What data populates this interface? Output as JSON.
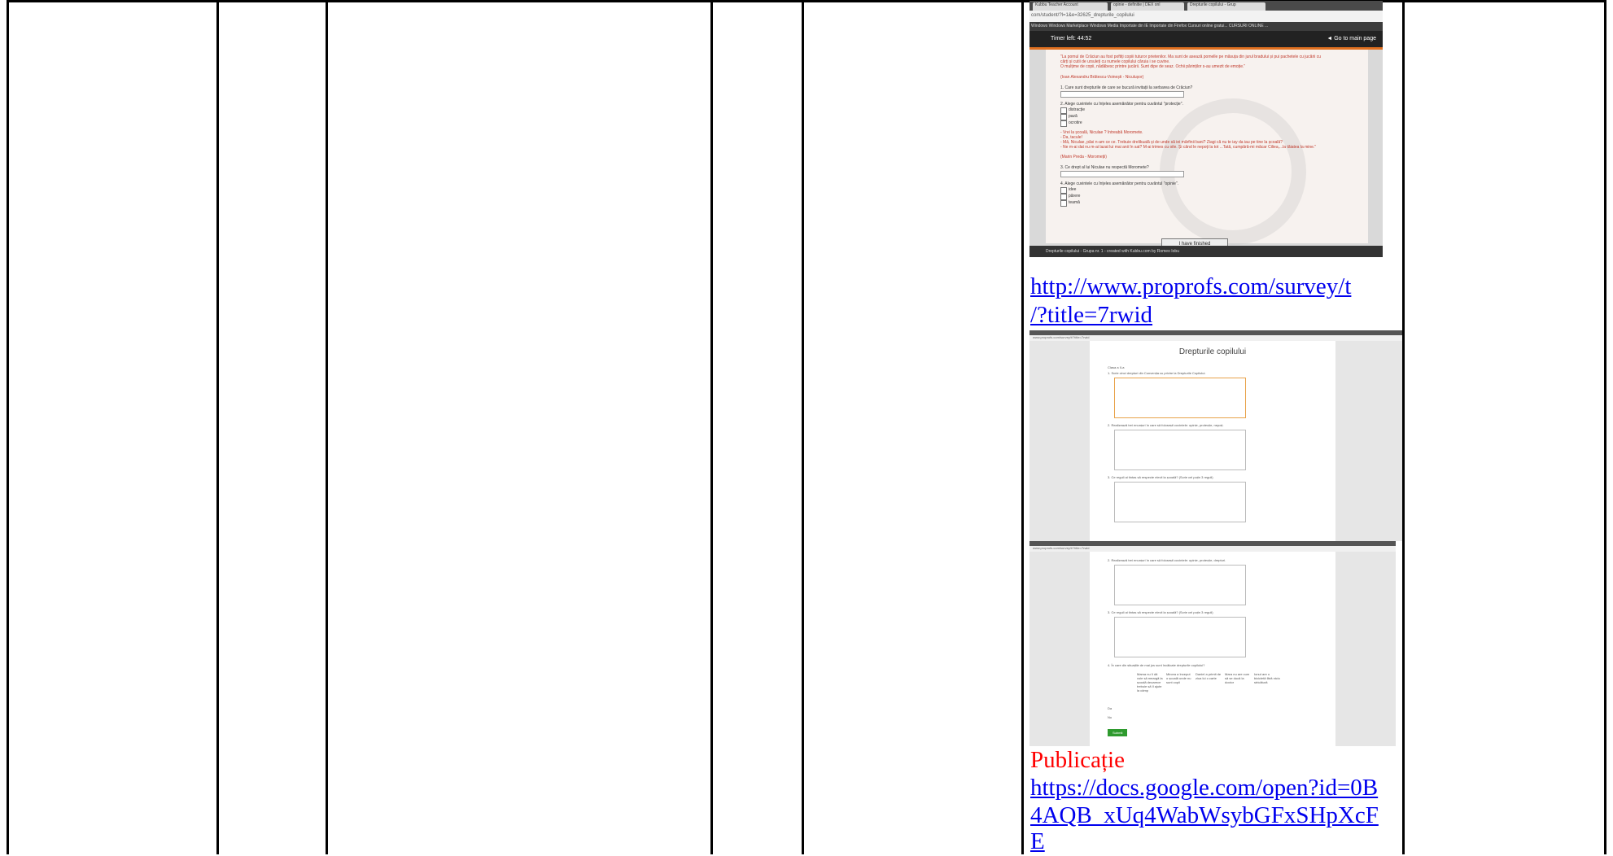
{
  "kubbu_screenshot": {
    "tabs": [
      "Kubbu Teacher Account",
      "opinie - definitie | DEX onl",
      "Drepturile copilului - Grup"
    ],
    "url": "com/student/?l=1&e=32625_drepturile_copilului",
    "bookmarks": "Windows  Windows Marketplace  Windows Media  Importate din IE  Importate din Firefox  Cursuri online gratui...  CURSURI ONLINE ...",
    "timer": "Timer left: 44:52",
    "back_label": "◄ Go to main page",
    "lines": [
      {
        "text": "\"La pomul de Crăciun au fost poftiți copiii tuturor prietenilor. Ma sunt de asează pomelle pe măsuța din jurul bradului și pui pachetele cu jucării cu",
        "red": true
      },
      {
        "text": "cărți și cutii de ursuleți cu numele copilului căruia i se cuvine.",
        "red": true
      },
      {
        "text": "O mulțime de copii, nădăbesc printre jucării. Sunt dipe de seaz. Ochii părinților s-au umezit de emoție.\"",
        "red": true
      },
      {
        "text": "(Ioan Alexandru Brătescu-Voinești - Niculușor)",
        "red": true
      },
      {
        "text": "1. Care sunt drepturile de care se bucură invitații la serbarea de Crăciun?",
        "red": false
      },
      {
        "text": "2. Alege cuvintele cu înțeles asemănător pentru cuvântul \"protecție\".",
        "red": false
      },
      {
        "text": "distracție",
        "red": false
      },
      {
        "text": "pază",
        "red": false
      },
      {
        "text": "ocrotire",
        "red": false
      },
      {
        "text": "- Vrei la școală, Niculae ? întreabă Moromete.",
        "red": true
      },
      {
        "text": "- Da, tacule!",
        "red": true
      },
      {
        "text": "- Mă, Niculae, păsi n-am ce ce. Trebuie drelikuală și de unde să iei mărfinii bani? Ziagi că nu te iay da iau pe tine la școală?",
        "red": true
      },
      {
        "text": "- Ne m-ai dat nu m-ai lazat lui mai anii în sat? M-ai trimes cu oile. Și când le nepoți la tot ...Tată, cumpără-mi măcar Ciliea,...la tăiatea la mine.\"",
        "red": true
      },
      {
        "text": "(Marin Preda - Moromeții)",
        "red": true
      },
      {
        "text": "3. Ce drept al lui Niculae nu respectă Moromete?",
        "red": false
      },
      {
        "text": "4. Alege cuvintele cu înțeles asemănător pentru cuvântul \"opinie\".",
        "red": false
      },
      {
        "text": "idee",
        "red": false
      },
      {
        "text": "părere",
        "red": false
      },
      {
        "text": "teamă",
        "red": false
      }
    ],
    "button": "I have finished",
    "footer": "Drepturile copilului - Grupa nr. 1 - created with Kubbu.com by Romeo Iobu",
    "watermark": "kubbu free licence"
  },
  "link1": {
    "line1": "http://www.proprofs.com/survey/t",
    "line2": "/?title=7rwid"
  },
  "proprofs1": {
    "tab": "ProProfs survey - Google Chrome",
    "url": "www.proprofs.com/survey/t/?title=7rwid",
    "title": "Drepturile copilului",
    "intro": "Clasa a II-a",
    "q1": "1.   Scrie cinci drepturi din Convenția cu privire la Drepturile Copilului.",
    "q2": "2.   Realizează trei enunțuri în care să folosești cuvintele: opinie, protecție, nepoți.",
    "q3": "3.   Ce reguli ai tintas să respecte elevii la școală? (Scrie cel puțin 3 reguli)"
  },
  "proprofs2": {
    "tab": "ProProfs survey - Google Chrome",
    "url": "www.proprofs.com/survey/t/?title=7rwid",
    "q2": "2.   Realizează trei enunțuri în care să folosești cuvintele: opinie, protecție, drepturi.",
    "q3": "3.   Ce reguli ai tintas să respecte elevii la școală? (Scrie cel puțin 3 reguli)",
    "q4": "4.   În care din situațiile de mai jos sunt încălcate drepturile copilului?",
    "cols": [
      "Mama nu îi dă voie să meargă la școală deoarece trebuie să îl ajute la câmp",
      "Mircea a început o școală unde nu sunt copii",
      "Daniel a primit de ziua lui o carte",
      "Mara nu are cum să se ducă la doctor",
      "Ionut are o bicicletă fără nicio stricătură"
    ],
    "rows": [
      "Da",
      "Nu"
    ],
    "submit": "Submit"
  },
  "publication_label": "Publicație",
  "link2": {
    "line1": "https://docs.google.com/open?id=0B",
    "line2": "4AQB_xUq4WabWsybGFxSHpXcF",
    "line3": "E"
  }
}
